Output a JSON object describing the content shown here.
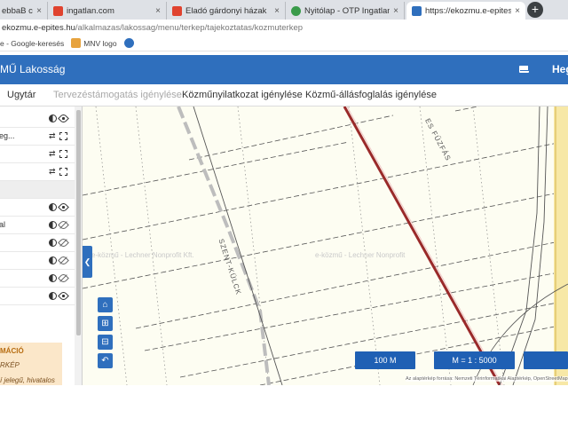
{
  "browser": {
    "tabs": [
      {
        "title": "ebbaB ctpk",
        "favicon_color": "#4c8bf5",
        "active": false
      },
      {
        "title": "ingatlan.com",
        "favicon_color": "#e0432f",
        "active": false
      },
      {
        "title": "Eladó gárdonyi házak",
        "favicon_color": "#e0432f",
        "active": false
      },
      {
        "title": "Nyitólap - OTP Ingatlanpont In",
        "favicon_color": "#3a9b4a",
        "active": false
      },
      {
        "title": "https://ekozmu.e-epites.hu/al",
        "favicon_color": "#2f6fbd",
        "active": true
      }
    ],
    "tab_close_glyph": "×",
    "new_tab_glyph": "+",
    "address": {
      "host": "ekozmu.e-epites.hu",
      "path": "/alkalmazas/lakossag/menu/terkep/tajekoztatas/kozmuterkep"
    },
    "bookmarks": [
      {
        "label": "e - Google-keresés",
        "icon_color": "#4c8bf5"
      },
      {
        "label": "MNV logo",
        "icon_color": "#e7a33e"
      },
      {
        "label": "",
        "icon_color": "#2f6fbd"
      }
    ]
  },
  "header": {
    "title": "MŰ Lakosság",
    "user": "Heg",
    "mail_icon": "mail-icon",
    "bg_color": "#2f6fbd"
  },
  "nav": {
    "items": [
      {
        "label": "Ugytár",
        "disabled": false
      },
      {
        "label": "Tervezéstámogatás igénylése",
        "disabled": true
      },
      {
        "label": "Közműnyilatkozat igénylése",
        "disabled": false
      },
      {
        "label": "Közmű-állásfoglalás igénylése",
        "disabled": false
      }
    ]
  },
  "layers": {
    "rows": [
      {
        "label": "",
        "icons": [
          "opacity-icon",
          "eye-icon"
        ]
      },
      {
        "label": "eg...",
        "icons": [
          "move-icon",
          "zoom-icon"
        ]
      },
      {
        "label": "",
        "icons": [
          "move-icon",
          "zoom-icon"
        ]
      },
      {
        "label": "",
        "icons": [
          "move-icon",
          "zoom-icon"
        ]
      },
      {
        "label": "",
        "icons": [],
        "section": true
      },
      {
        "label": "",
        "icons": [
          "opacity-icon",
          "eye-icon"
        ]
      },
      {
        "label": "al",
        "icons": [
          "opacity-icon",
          "eye-off-icon"
        ]
      },
      {
        "label": "",
        "icons": [
          "opacity-icon",
          "eye-off-icon"
        ]
      },
      {
        "label": "",
        "icons": [
          "opacity-icon",
          "eye-off-icon"
        ]
      },
      {
        "label": "",
        "icons": [
          "opacity-icon",
          "eye-off-icon"
        ]
      },
      {
        "label": "",
        "icons": [
          "opacity-icon",
          "eye-icon"
        ]
      }
    ],
    "info": {
      "title": "MÁCIÓ",
      "subtitle": "RKÉP",
      "text": "í jelegű, hivatalos"
    }
  },
  "map": {
    "street_labels": [
      "ES FŰZFÁS",
      "SZENT-KÜLCK"
    ],
    "watermark_left": "e-közmű - Lechner Nonprofit Kft.",
    "watermark_right": "e-közmű - Lechner Nonprofit",
    "tools": [
      "home-icon",
      "layers-icon",
      "print-icon",
      "undo-icon"
    ],
    "collapse_glyph": "❮",
    "scale_distance": "100 M",
    "scale_ratio": "M = 1 : 5000",
    "attribution": "Az alaptérkép forrása: Nemzeti Térinformatikai Alaptérkép, OpenStreetMap"
  }
}
